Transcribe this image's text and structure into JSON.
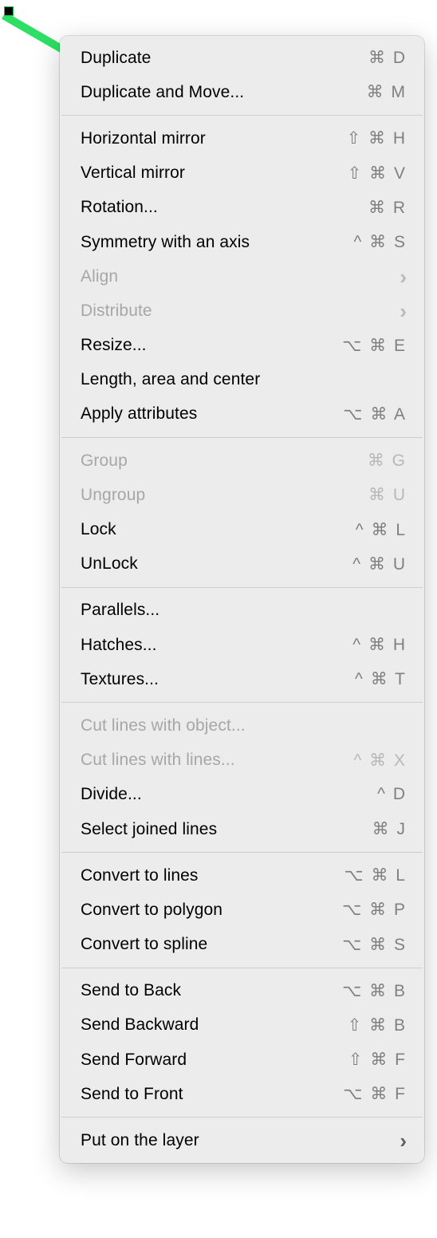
{
  "menu": {
    "groups": [
      [
        {
          "id": "duplicate",
          "label": "Duplicate",
          "shortcut": "⌘D",
          "disabled": false,
          "submenu": false
        },
        {
          "id": "duplicate-and-move",
          "label": "Duplicate and Move...",
          "shortcut": "⌘M",
          "disabled": false,
          "submenu": false
        }
      ],
      [
        {
          "id": "horizontal-mirror",
          "label": "Horizontal mirror",
          "shortcut": "⇧⌘H",
          "disabled": false,
          "submenu": false
        },
        {
          "id": "vertical-mirror",
          "label": "Vertical mirror",
          "shortcut": "⇧⌘V",
          "disabled": false,
          "submenu": false
        },
        {
          "id": "rotation",
          "label": "Rotation...",
          "shortcut": "⌘R",
          "disabled": false,
          "submenu": false
        },
        {
          "id": "symmetry-axis",
          "label": "Symmetry with an axis",
          "shortcut": "^⌘S",
          "disabled": false,
          "submenu": false
        },
        {
          "id": "align",
          "label": "Align",
          "shortcut": "",
          "disabled": true,
          "submenu": true
        },
        {
          "id": "distribute",
          "label": "Distribute",
          "shortcut": "",
          "disabled": true,
          "submenu": true
        },
        {
          "id": "resize",
          "label": "Resize...",
          "shortcut": "⌥⌘E",
          "disabled": false,
          "submenu": false
        },
        {
          "id": "length-area-center",
          "label": "Length, area and center",
          "shortcut": "",
          "disabled": false,
          "submenu": false
        },
        {
          "id": "apply-attributes",
          "label": "Apply attributes",
          "shortcut": "⌥⌘A",
          "disabled": false,
          "submenu": false
        }
      ],
      [
        {
          "id": "group",
          "label": "Group",
          "shortcut": "⌘G",
          "disabled": true,
          "submenu": false
        },
        {
          "id": "ungroup",
          "label": "Ungroup",
          "shortcut": "⌘U",
          "disabled": true,
          "submenu": false
        },
        {
          "id": "lock",
          "label": "Lock",
          "shortcut": "^⌘L",
          "disabled": false,
          "submenu": false
        },
        {
          "id": "unlock",
          "label": "UnLock",
          "shortcut": "^⌘U",
          "disabled": false,
          "submenu": false
        }
      ],
      [
        {
          "id": "parallels",
          "label": "Parallels...",
          "shortcut": "",
          "disabled": false,
          "submenu": false
        },
        {
          "id": "hatches",
          "label": "Hatches...",
          "shortcut": "^⌘H",
          "disabled": false,
          "submenu": false
        },
        {
          "id": "textures",
          "label": "Textures...",
          "shortcut": "^⌘T",
          "disabled": false,
          "submenu": false
        }
      ],
      [
        {
          "id": "cut-lines-object",
          "label": "Cut lines with object...",
          "shortcut": "",
          "disabled": true,
          "submenu": false
        },
        {
          "id": "cut-lines-lines",
          "label": "Cut lines with lines...",
          "shortcut": "^⌘X",
          "disabled": true,
          "submenu": false
        },
        {
          "id": "divide",
          "label": "Divide...",
          "shortcut": "^D",
          "disabled": false,
          "submenu": false
        },
        {
          "id": "select-joined",
          "label": "Select joined lines",
          "shortcut": "⌘J",
          "disabled": false,
          "submenu": false
        }
      ],
      [
        {
          "id": "convert-lines",
          "label": "Convert to lines",
          "shortcut": "⌥⌘L",
          "disabled": false,
          "submenu": false
        },
        {
          "id": "convert-polygon",
          "label": "Convert to polygon",
          "shortcut": "⌥⌘P",
          "disabled": false,
          "submenu": false
        },
        {
          "id": "convert-spline",
          "label": "Convert to spline",
          "shortcut": "⌥⌘S",
          "disabled": false,
          "submenu": false
        }
      ],
      [
        {
          "id": "send-to-back",
          "label": "Send to Back",
          "shortcut": "⌥⌘B",
          "disabled": false,
          "submenu": false
        },
        {
          "id": "send-backward",
          "label": "Send Backward",
          "shortcut": "⇧⌘B",
          "disabled": false,
          "submenu": false
        },
        {
          "id": "send-forward",
          "label": "Send Forward",
          "shortcut": "⇧⌘F",
          "disabled": false,
          "submenu": false
        },
        {
          "id": "send-to-front",
          "label": "Send to Front",
          "shortcut": "⌥⌘F",
          "disabled": false,
          "submenu": false
        }
      ],
      [
        {
          "id": "put-on-layer",
          "label": "Put on the layer",
          "shortcut": "",
          "disabled": false,
          "submenu": true
        }
      ]
    ]
  }
}
